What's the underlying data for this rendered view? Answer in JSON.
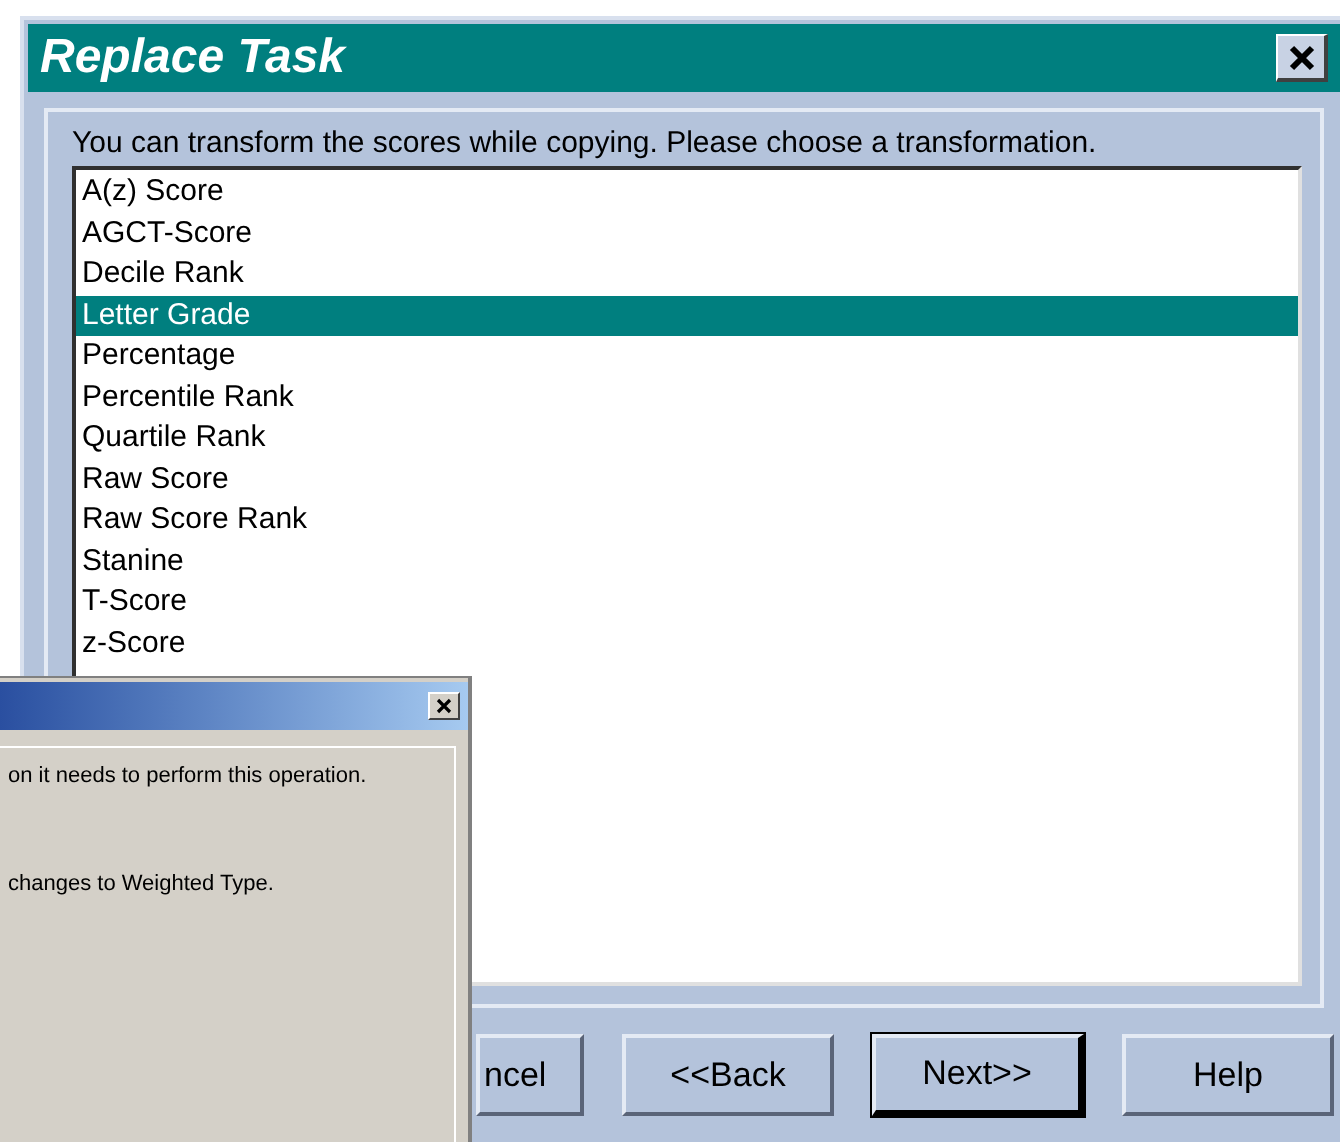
{
  "window": {
    "title": "Replace Task"
  },
  "prompt": "You can transform the scores while copying. Please choose a transformation.",
  "transformations": [
    {
      "label": "A(z) Score",
      "selected": false
    },
    {
      "label": "AGCT-Score",
      "selected": false
    },
    {
      "label": "Decile Rank",
      "selected": false
    },
    {
      "label": "Letter Grade",
      "selected": true
    },
    {
      "label": "Percentage",
      "selected": false
    },
    {
      "label": "Percentile Rank",
      "selected": false
    },
    {
      "label": "Quartile Rank",
      "selected": false
    },
    {
      "label": "Raw Score",
      "selected": false
    },
    {
      "label": "Raw Score Rank",
      "selected": false
    },
    {
      "label": "Stanine",
      "selected": false
    },
    {
      "label": "T-Score",
      "selected": false
    },
    {
      "label": "z-Score",
      "selected": false
    }
  ],
  "buttons": [
    {
      "label": "ncel",
      "default": false
    },
    {
      "label": "<<Back",
      "default": false
    },
    {
      "label": "Next>>",
      "default": true
    },
    {
      "label": "Help",
      "default": false
    }
  ],
  "overlay_dialog": {
    "lines": [
      "on it needs to perform this operation.",
      "changes to Weighted Type."
    ]
  }
}
